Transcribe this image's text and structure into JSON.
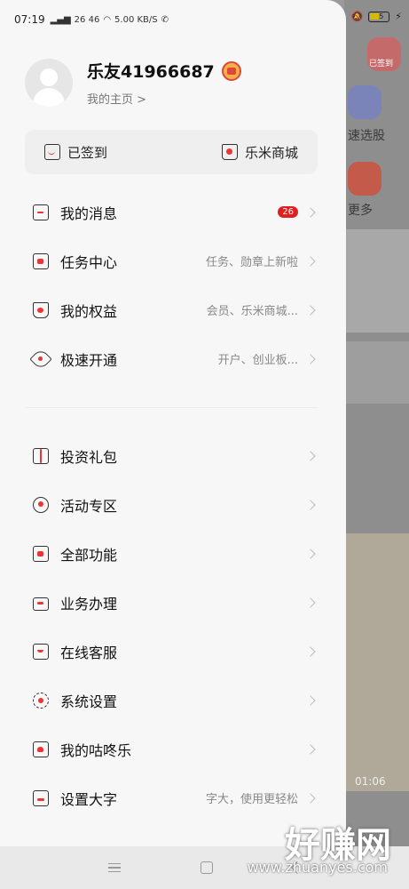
{
  "status_bar": {
    "time": "07:19",
    "signals": "26 46",
    "speed": "5.00 KB/S",
    "battery": "35"
  },
  "profile": {
    "username": "乐友41966687",
    "home_link": "我的主页 >"
  },
  "quick_bar": {
    "checkin_label": "已签到",
    "mall_label": "乐米商城"
  },
  "menu_group_1": [
    {
      "label": "我的消息",
      "sub": "",
      "count": "26"
    },
    {
      "label": "任务中心",
      "sub": "任务、勋章上新啦",
      "count": ""
    },
    {
      "label": "我的权益",
      "sub": "会员、乐米商城...",
      "count": ""
    },
    {
      "label": "极速开通",
      "sub": "开户、创业板...",
      "count": ""
    }
  ],
  "menu_group_2": [
    {
      "label": "投资礼包",
      "sub": ""
    },
    {
      "label": "活动专区",
      "sub": ""
    },
    {
      "label": "全部功能",
      "sub": ""
    },
    {
      "label": "业务办理",
      "sub": ""
    },
    {
      "label": "在线客服",
      "sub": ""
    },
    {
      "label": "系统设置",
      "sub": ""
    },
    {
      "label": "我的咕咚乐",
      "sub": ""
    },
    {
      "label": "设置大字",
      "sub": "字大，使用更轻松"
    }
  ],
  "background": {
    "signed_badge": "已签到",
    "quick_select": "速选股",
    "more": "更多",
    "video_time": "01:06"
  },
  "watermark": {
    "text": "好赚网",
    "url": "www.zhuanyes.com"
  }
}
